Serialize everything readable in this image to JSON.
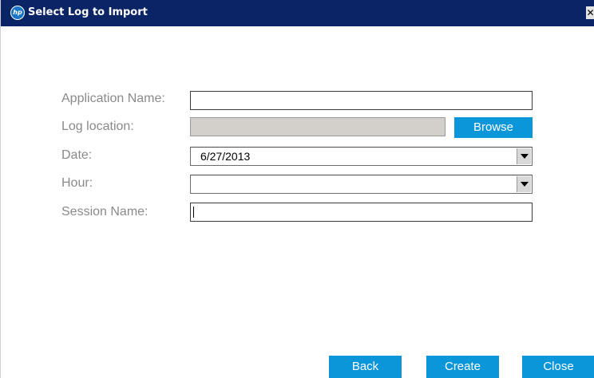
{
  "window": {
    "title": "Select Log to Import",
    "logo_text": "hp",
    "close_glyph": "✕"
  },
  "form": {
    "application_name": {
      "label": "Application Name:",
      "value": ""
    },
    "log_location": {
      "label": "Log location:",
      "value": "",
      "browse_label": "Browse"
    },
    "date": {
      "label": "Date:",
      "value": "6/27/2013"
    },
    "hour": {
      "label": "Hour:",
      "value": ""
    },
    "session_name": {
      "label": "Session Name:",
      "value": ""
    }
  },
  "footer": {
    "back_label": "Back",
    "create_label": "Create",
    "close_label": "Close"
  },
  "colors": {
    "title_bar": "#0b2466",
    "accent_button": "#0b96d9",
    "label_text": "#8a8a8a",
    "disabled_field": "#d3d0cb"
  }
}
